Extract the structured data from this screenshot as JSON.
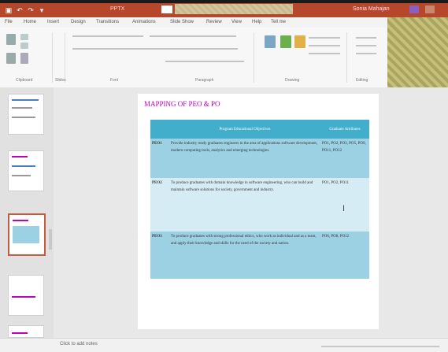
{
  "window": {
    "title": "PPTX",
    "user": "Sonia Mahajan"
  },
  "ribbon": {
    "tabs": [
      "File",
      "Home",
      "Insert",
      "Design",
      "Transitions",
      "Animations",
      "Slide Show",
      "Review",
      "View",
      "Help",
      "Tell me"
    ],
    "groups": [
      "Clipboard",
      "Slides",
      "Font",
      "Paragraph",
      "Drawing",
      "Editing"
    ]
  },
  "slide": {
    "title": "MAPPING OF PEO & PO",
    "table": {
      "headers": [
        "",
        "Program Educational Objectives",
        "Graduate Attributes"
      ],
      "rows": [
        {
          "code": "PEO1",
          "objective": "Provide industry ready graduates engineers in the area of applications software development, modern computing tools, analytics and emerging technologies.",
          "outcomes": "PO1, PO2, PO3, PO5, PO9, PO11, PO12"
        },
        {
          "code": "PEO2",
          "objective": "To produce graduates with domain knowledge in software engineering, who can build and maintain software solutions for society, government and industry.",
          "outcomes": "PO1, PO2, PO11"
        },
        {
          "code": "PEO3",
          "objective": "To produce graduates with strong professional ethics, who work as individual and as a team, and apply their knowledge and skills for the need of the society and nation.",
          "outcomes": "PO6, PO8, PO12"
        }
      ]
    }
  },
  "status": {
    "notes": "Click to add notes"
  },
  "colors": {
    "title_bar": "#b7472a",
    "title_text": "#c000c0",
    "table_header": "#43aecb",
    "row_dark": "#9bd1e3",
    "row_light": "#d6ecf4"
  }
}
